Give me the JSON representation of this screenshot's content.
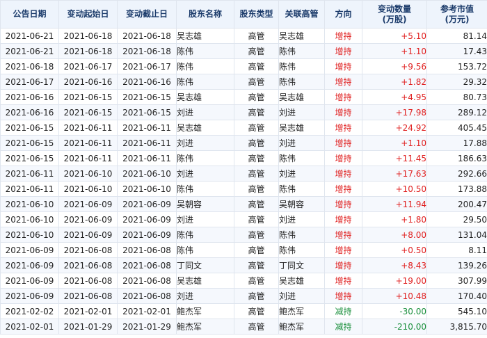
{
  "headers": {
    "date": "公告日期",
    "start": "变动起始日",
    "end": "变动截止日",
    "name": "股东名称",
    "type": "股东类型",
    "related": "关联高管",
    "direction": "方向",
    "qty_line1": "变动数量",
    "qty_line2": "(万股)",
    "mv_line1": "参考市值",
    "mv_line2": "(万元)"
  },
  "colors": {
    "increase": "#e02020",
    "decrease": "#1a8f3c",
    "header_bg": "#eef4fc",
    "alt_row_bg": "#f5f8fd"
  },
  "rows": [
    {
      "date": "2021-06-21",
      "start": "2021-06-18",
      "end": "2021-06-18",
      "name": "吴志雄",
      "type": "高管",
      "related": "吴志雄",
      "direction": "增持",
      "qty": "+5.10",
      "mv": "81.14",
      "trend": "up"
    },
    {
      "date": "2021-06-21",
      "start": "2021-06-18",
      "end": "2021-06-18",
      "name": "陈伟",
      "type": "高管",
      "related": "陈伟",
      "direction": "增持",
      "qty": "+1.10",
      "mv": "17.43",
      "trend": "up"
    },
    {
      "date": "2021-06-18",
      "start": "2021-06-17",
      "end": "2021-06-17",
      "name": "陈伟",
      "type": "高管",
      "related": "陈伟",
      "direction": "增持",
      "qty": "+9.56",
      "mv": "153.72",
      "trend": "up"
    },
    {
      "date": "2021-06-17",
      "start": "2021-06-16",
      "end": "2021-06-16",
      "name": "陈伟",
      "type": "高管",
      "related": "陈伟",
      "direction": "增持",
      "qty": "+1.82",
      "mv": "29.32",
      "trend": "up"
    },
    {
      "date": "2021-06-16",
      "start": "2021-06-15",
      "end": "2021-06-15",
      "name": "吴志雄",
      "type": "高管",
      "related": "吴志雄",
      "direction": "增持",
      "qty": "+4.95",
      "mv": "80.73",
      "trend": "up"
    },
    {
      "date": "2021-06-16",
      "start": "2021-06-15",
      "end": "2021-06-15",
      "name": "刘进",
      "type": "高管",
      "related": "刘进",
      "direction": "增持",
      "qty": "+17.98",
      "mv": "289.12",
      "trend": "up"
    },
    {
      "date": "2021-06-15",
      "start": "2021-06-11",
      "end": "2021-06-11",
      "name": "吴志雄",
      "type": "高管",
      "related": "吴志雄",
      "direction": "增持",
      "qty": "+24.92",
      "mv": "405.45",
      "trend": "up"
    },
    {
      "date": "2021-06-15",
      "start": "2021-06-11",
      "end": "2021-06-11",
      "name": "刘进",
      "type": "高管",
      "related": "刘进",
      "direction": "增持",
      "qty": "+1.10",
      "mv": "17.88",
      "trend": "up"
    },
    {
      "date": "2021-06-15",
      "start": "2021-06-11",
      "end": "2021-06-11",
      "name": "陈伟",
      "type": "高管",
      "related": "陈伟",
      "direction": "增持",
      "qty": "+11.45",
      "mv": "186.63",
      "trend": "up"
    },
    {
      "date": "2021-06-11",
      "start": "2021-06-10",
      "end": "2021-06-10",
      "name": "刘进",
      "type": "高管",
      "related": "刘进",
      "direction": "增持",
      "qty": "+17.63",
      "mv": "292.66",
      "trend": "up"
    },
    {
      "date": "2021-06-11",
      "start": "2021-06-10",
      "end": "2021-06-10",
      "name": "陈伟",
      "type": "高管",
      "related": "陈伟",
      "direction": "增持",
      "qty": "+10.50",
      "mv": "173.88",
      "trend": "up"
    },
    {
      "date": "2021-06-10",
      "start": "2021-06-09",
      "end": "2021-06-09",
      "name": "吴朝容",
      "type": "高管",
      "related": "吴朝容",
      "direction": "增持",
      "qty": "+11.94",
      "mv": "200.47",
      "trend": "up"
    },
    {
      "date": "2021-06-10",
      "start": "2021-06-09",
      "end": "2021-06-09",
      "name": "刘进",
      "type": "高管",
      "related": "刘进",
      "direction": "增持",
      "qty": "+1.80",
      "mv": "29.50",
      "trend": "up"
    },
    {
      "date": "2021-06-10",
      "start": "2021-06-09",
      "end": "2021-06-09",
      "name": "陈伟",
      "type": "高管",
      "related": "陈伟",
      "direction": "增持",
      "qty": "+8.00",
      "mv": "131.04",
      "trend": "up"
    },
    {
      "date": "2021-06-09",
      "start": "2021-06-08",
      "end": "2021-06-08",
      "name": "陈伟",
      "type": "高管",
      "related": "陈伟",
      "direction": "增持",
      "qty": "+0.50",
      "mv": "8.11",
      "trend": "up"
    },
    {
      "date": "2021-06-09",
      "start": "2021-06-08",
      "end": "2021-06-08",
      "name": "丁同文",
      "type": "高管",
      "related": "丁同文",
      "direction": "增持",
      "qty": "+8.43",
      "mv": "139.26",
      "trend": "up"
    },
    {
      "date": "2021-06-09",
      "start": "2021-06-08",
      "end": "2021-06-08",
      "name": "吴志雄",
      "type": "高管",
      "related": "吴志雄",
      "direction": "增持",
      "qty": "+19.00",
      "mv": "307.99",
      "trend": "up"
    },
    {
      "date": "2021-06-09",
      "start": "2021-06-08",
      "end": "2021-06-08",
      "name": "刘进",
      "type": "高管",
      "related": "刘进",
      "direction": "增持",
      "qty": "+10.48",
      "mv": "170.40",
      "trend": "up"
    },
    {
      "date": "2021-02-02",
      "start": "2021-02-01",
      "end": "2021-02-01",
      "name": "鲍杰军",
      "type": "高管",
      "related": "鲍杰军",
      "direction": "减持",
      "qty": "-30.00",
      "mv": "545.10",
      "trend": "down"
    },
    {
      "date": "2021-02-01",
      "start": "2021-01-29",
      "end": "2021-01-29",
      "name": "鲍杰军",
      "type": "高管",
      "related": "鲍杰军",
      "direction": "减持",
      "qty": "-210.00",
      "mv": "3,815.70",
      "trend": "down"
    }
  ]
}
